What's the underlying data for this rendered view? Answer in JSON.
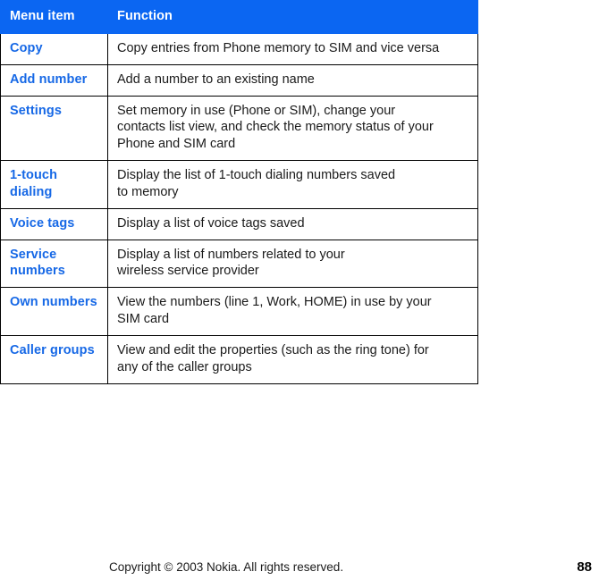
{
  "table": {
    "headers": {
      "menu_item": "Menu item",
      "function": "Function"
    },
    "header_bg_color": "#0b66f2",
    "header_text_color": "#ffffff",
    "menu_item_color": "#1668e6",
    "rows": [
      {
        "menu_item": "Copy",
        "function_lines": [
          "Copy entries from Phone memory to SIM and vice versa"
        ]
      },
      {
        "menu_item": "Add number",
        "function_lines": [
          "Add a number to an existing name"
        ]
      },
      {
        "menu_item": "Settings",
        "function_lines": [
          "Set memory in use (Phone or SIM), change your",
          "contacts list view, and check the memory status of your",
          "Phone and SIM card"
        ]
      },
      {
        "menu_item": "1-touch dialing",
        "function_lines": [
          "Display the list of 1-touch dialing numbers saved",
          "to memory"
        ]
      },
      {
        "menu_item": "Voice tags",
        "function_lines": [
          "Display a list of voice tags saved"
        ]
      },
      {
        "menu_item": "Service numbers",
        "function_lines": [
          "Display a list of numbers related to your",
          "wireless service provider"
        ]
      },
      {
        "menu_item": "Own numbers",
        "function_lines": [
          "View the numbers (line 1, Work, HOME) in use by your",
          "SIM card"
        ]
      },
      {
        "menu_item": "Caller groups",
        "function_lines": [
          "View and edit the properties (such as the ring tone) for",
          "any of the caller groups"
        ]
      }
    ]
  },
  "footer": {
    "copyright": "Copyright © 2003 Nokia. All rights reserved.",
    "page_number": "88"
  }
}
